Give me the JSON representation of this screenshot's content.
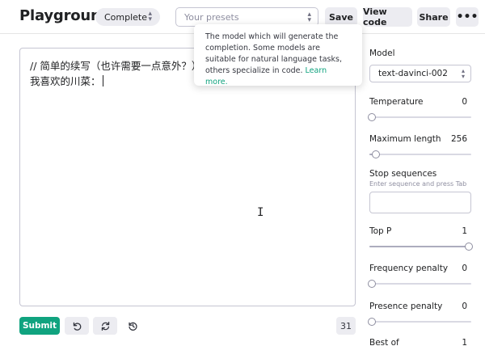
{
  "header": {
    "title": "Playground",
    "mode": "Complete",
    "presets_placeholder": "Your presets",
    "save_label": "Save",
    "view_code_label": "View code",
    "share_label": "Share",
    "more_label": "•••"
  },
  "tooltip": {
    "text": "The model which will generate the completion. Some models are suitable for natural language tasks, others specialize in code. ",
    "link": "Learn more."
  },
  "editor": {
    "line1": "// 简单的续写（也许需要一点意外？）",
    "line2": "我喜欢的川菜："
  },
  "footer": {
    "submit_label": "Submit",
    "token_count": "31"
  },
  "settings": {
    "model_label": "Model",
    "model_value": "text-davinci-002",
    "temperature": {
      "label": "Temperature",
      "value": "0",
      "fraction": 0.0
    },
    "max_length": {
      "label": "Maximum length",
      "value": "256",
      "fraction": 0.06
    },
    "stop_sequences": {
      "label": "Stop sequences",
      "hint": "Enter sequence and press Tab"
    },
    "top_p": {
      "label": "Top P",
      "value": "1",
      "fraction": 1.0
    },
    "frequency_penalty": {
      "label": "Frequency penalty",
      "value": "0",
      "fraction": 0.0
    },
    "presence_penalty": {
      "label": "Presence penalty",
      "value": "0",
      "fraction": 0.0
    },
    "best_of": {
      "label": "Best of",
      "value": "1"
    }
  },
  "colors": {
    "accent": "#10a37f",
    "button_bg": "#ececf1",
    "border": "#c5c5d2"
  },
  "icons": [
    "chevron-updown-icon",
    "undo-icon",
    "regenerate-icon",
    "history-icon",
    "text-cursor-icon"
  ]
}
